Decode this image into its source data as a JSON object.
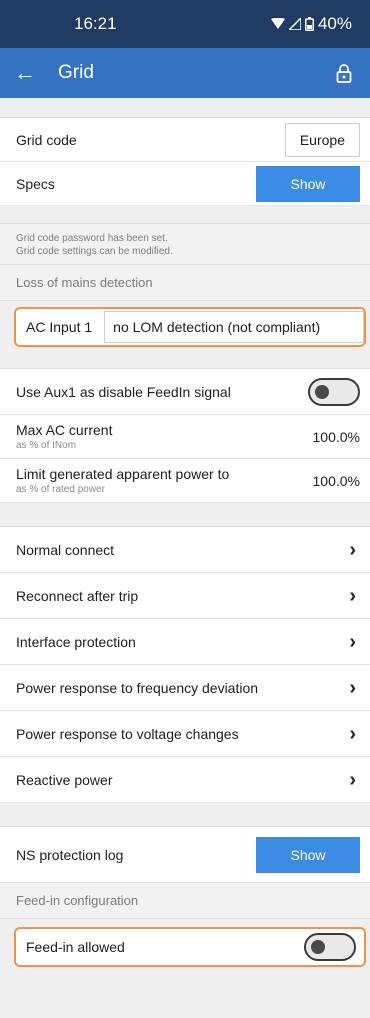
{
  "status_bar": {
    "time": "16:21",
    "battery": "40%"
  },
  "app_bar": {
    "title": "Grid"
  },
  "grid_code": {
    "label": "Grid code",
    "value": "Europe"
  },
  "specs": {
    "label": "Specs",
    "button": "Show"
  },
  "note": {
    "line1": "Grid code password has been set.",
    "line2": "Grid code settings can be modified."
  },
  "lom_section": {
    "title": "Loss of mains detection"
  },
  "ac_input": {
    "label": "AC Input 1",
    "value": "no LOM detection (not compliant)"
  },
  "aux": {
    "label": "Use Aux1 as disable FeedIn signal"
  },
  "max_ac": {
    "label": "Max AC current",
    "sub": "as % of INom",
    "value": "100.0%"
  },
  "limit_power": {
    "label": "Limit generated apparent power to",
    "sub": "as % of rated power",
    "value": "100.0%"
  },
  "menu_items": [
    {
      "label": "Normal connect"
    },
    {
      "label": "Reconnect after trip"
    },
    {
      "label": "Interface protection"
    },
    {
      "label": "Power response to frequency deviation"
    },
    {
      "label": "Power response to voltage changes"
    },
    {
      "label": "Reactive power"
    }
  ],
  "ns_log": {
    "label": "NS protection log",
    "button": "Show"
  },
  "feedin_section": {
    "title": "Feed-in configuration"
  },
  "feedin": {
    "label": "Feed-in allowed"
  },
  "colors": {
    "status_bar": "#1f3b63",
    "app_bar": "#3572c2",
    "button": "#3c8be3",
    "highlight": "#f0924a"
  }
}
